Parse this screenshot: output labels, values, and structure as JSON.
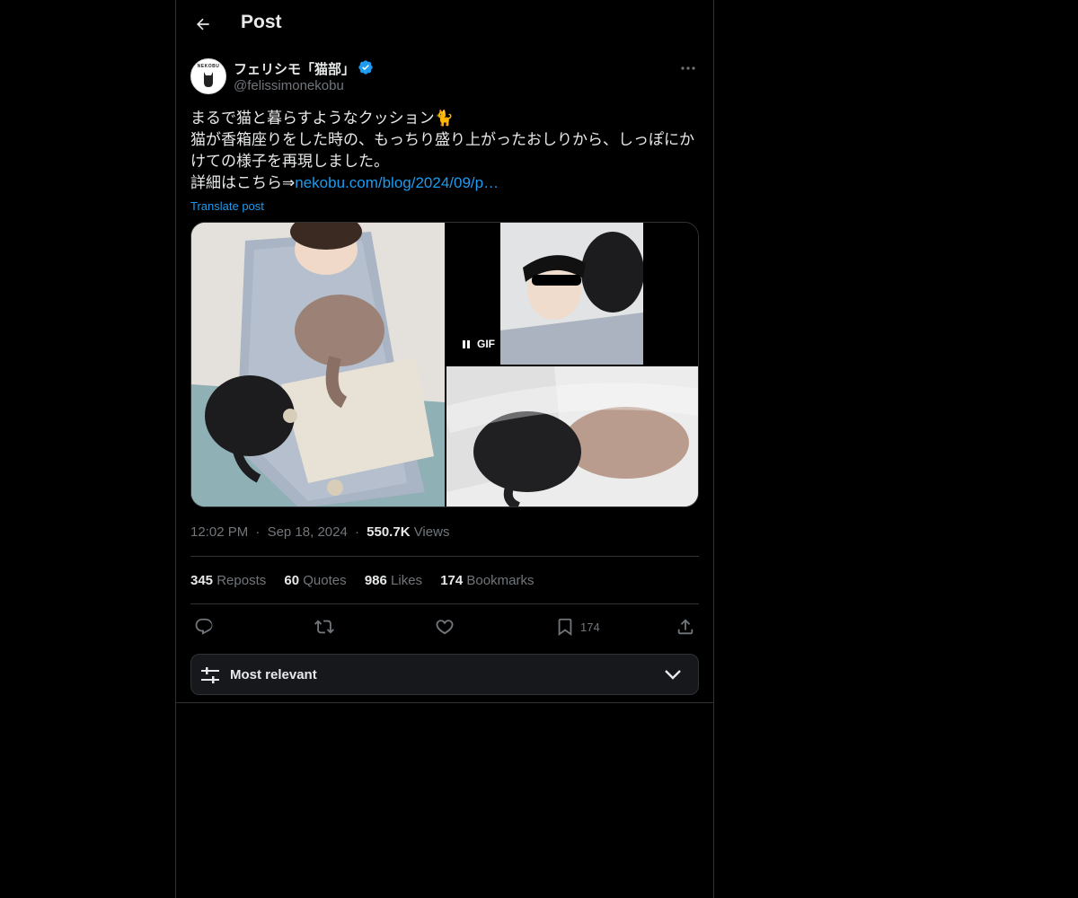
{
  "header": {
    "title": "Post"
  },
  "author": {
    "display_name": "フェリシモ「猫部」",
    "handle": "@felissimonekobu",
    "avatar_text": "NEKOBU",
    "verified_color": "#1d9bf0"
  },
  "post": {
    "lines": [
      "まるで猫と暮らすようなクッション🐈",
      "猫が香箱座りをした時の、もっちり盛り上がったおしりから、しっぽにか",
      "けての様子を再現しました。"
    ],
    "link_prefix": "詳細はこちら⇒",
    "link_text": "nekobu.com/blog/2024/09/p…",
    "translate": "Translate post",
    "gif_label": "GIF"
  },
  "meta": {
    "time": "12:02 PM",
    "sep": "·",
    "date": "Sep 18, 2024",
    "views_count": "550.7K",
    "views_label": "Views"
  },
  "stats": {
    "reposts_count": "345",
    "reposts_label": "Reposts",
    "quotes_count": "60",
    "quotes_label": "Quotes",
    "likes_count": "986",
    "likes_label": "Likes",
    "bookmarks_count": "174",
    "bookmarks_label": "Bookmarks"
  },
  "actions": {
    "bookmark_count": "174"
  },
  "sort": {
    "label": "Most relevant"
  },
  "colors": {
    "background": "#000000",
    "accent": "#1d9bf0",
    "muted": "#71767b",
    "border": "#2f3336"
  }
}
